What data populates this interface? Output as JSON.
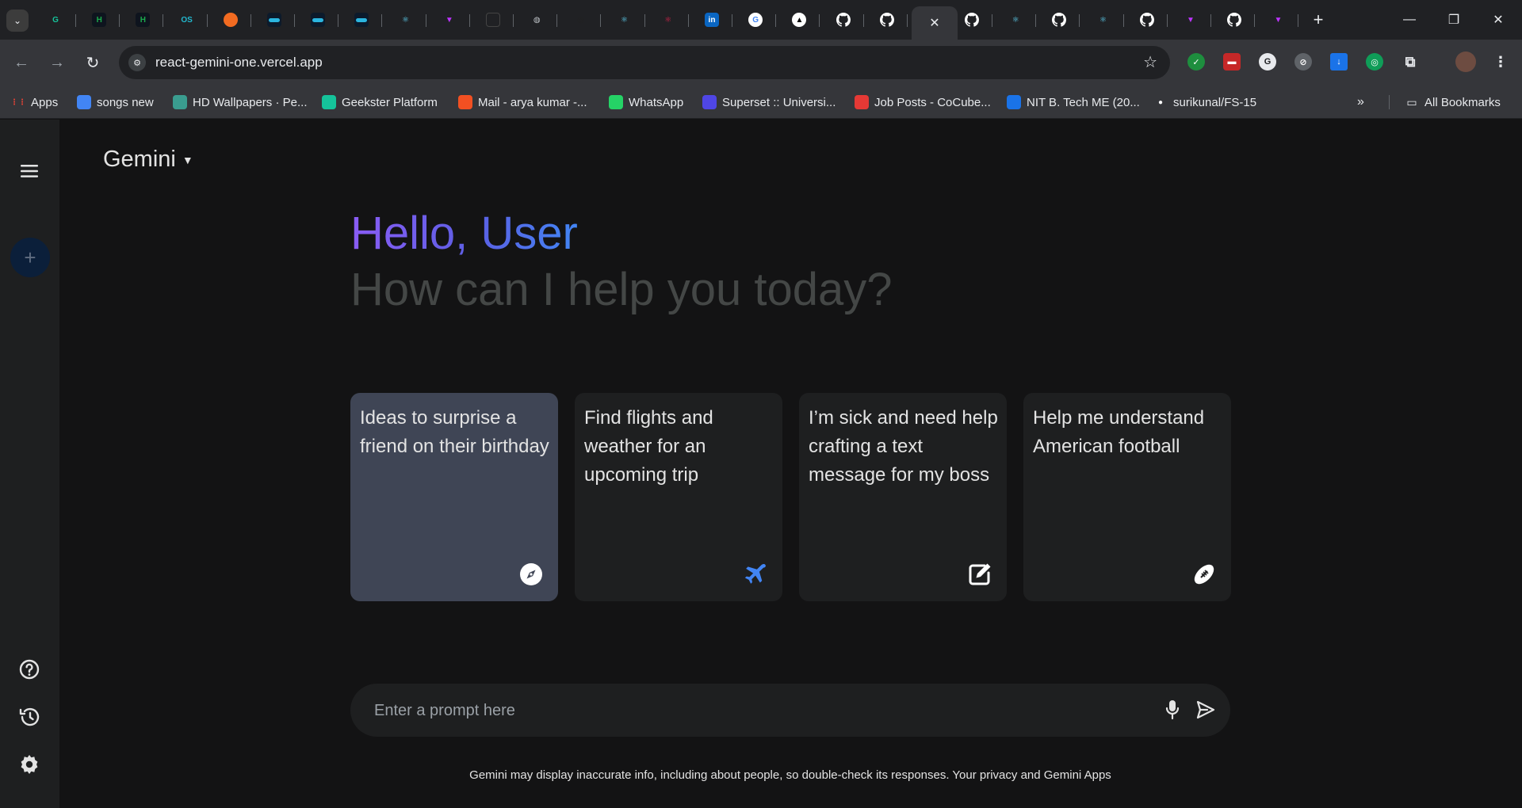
{
  "browser": {
    "tabs": [
      {
        "icon": "tab-list-icon"
      },
      {
        "icon": "grammarly-icon",
        "glyph": "G",
        "color": "#15c39a"
      },
      {
        "icon": "hackerrank-icon",
        "glyph": "H",
        "color": "#1ba94c"
      },
      {
        "icon": "hackerrank-icon",
        "glyph": "H",
        "color": "#1ba94c"
      },
      {
        "icon": "os-icon",
        "glyph": "OS",
        "color": "#22b8cf"
      },
      {
        "icon": "orange-circle-icon",
        "glyph": "",
        "color": "#f26b21"
      },
      {
        "icon": "dash-icon",
        "glyph": "",
        "color": "#2bb6e0"
      },
      {
        "icon": "dash-icon",
        "glyph": "",
        "color": "#2bb6e0"
      },
      {
        "icon": "dash-icon",
        "glyph": "",
        "color": "#2bb6e0"
      },
      {
        "icon": "react-icon",
        "glyph": "⚛",
        "color": "#61dafb"
      },
      {
        "icon": "vite-icon",
        "glyph": "▼",
        "color": "#bd34fe"
      },
      {
        "icon": "blank-icon",
        "glyph": "",
        "color": "#444"
      },
      {
        "icon": "globe-icon",
        "glyph": "◍",
        "color": "#bdc1c6"
      },
      {
        "icon": "openai-icon",
        "glyph": "◎",
        "color": "#222"
      },
      {
        "icon": "react-icon",
        "glyph": "⚛",
        "color": "#61dafb"
      },
      {
        "icon": "react-icon",
        "glyph": "⚛",
        "color": "#e0234e"
      },
      {
        "icon": "linkedin-icon",
        "glyph": "in",
        "color": "#0a66c2"
      },
      {
        "icon": "google-icon",
        "glyph": "G",
        "color": "#ffffff"
      },
      {
        "icon": "vercel-icon",
        "glyph": "▲",
        "color": "#ffffff"
      },
      {
        "icon": "github-icon",
        "glyph": "",
        "color": "#ffffff"
      },
      {
        "icon": "github-icon",
        "glyph": "",
        "color": "#ffffff"
      }
    ],
    "active_tab_close": "✕",
    "more_tabs": [
      {
        "icon": "github-icon",
        "glyph": "",
        "color": "#ffffff"
      },
      {
        "icon": "react-icon",
        "glyph": "⚛",
        "color": "#61dafb"
      },
      {
        "icon": "github-icon",
        "glyph": "",
        "color": "#ffffff"
      },
      {
        "icon": "react-icon",
        "glyph": "⚛",
        "color": "#61dafb"
      },
      {
        "icon": "github-icon",
        "glyph": "",
        "color": "#ffffff"
      },
      {
        "icon": "vite-icon",
        "glyph": "▼",
        "color": "#bd34fe"
      },
      {
        "icon": "github-icon",
        "glyph": "",
        "color": "#ffffff"
      },
      {
        "icon": "vite-icon",
        "glyph": "▼",
        "color": "#bd34fe"
      }
    ],
    "url": "react-gemini-one.vercel.app",
    "bookmarks": [
      {
        "label": "Apps",
        "icon": "apps-grid-icon",
        "color": "#ea4335"
      },
      {
        "label": "songs new",
        "icon": "radio-icon",
        "color": "#4285f4"
      },
      {
        "label": "HD Wallpapers · Pe...",
        "icon": "wallpaper-icon",
        "color": "#3a9d8f"
      },
      {
        "label": "Geekster Platform",
        "icon": "geekster-icon",
        "color": "#15c39a"
      },
      {
        "label": "Mail - arya kumar -...",
        "icon": "microsoft-icon",
        "color": "#f25022"
      },
      {
        "label": "WhatsApp",
        "icon": "whatsapp-icon",
        "color": "#25d366"
      },
      {
        "label": "Superset :: Universi...",
        "icon": "superset-icon",
        "color": "#4f46e5"
      },
      {
        "label": "Job Posts - CoCube...",
        "icon": "cocubes-icon",
        "color": "#e53935"
      },
      {
        "label": "NIT B. Tech ME (20...",
        "icon": "c-icon",
        "color": "#1a73e8"
      },
      {
        "label": "surikunal/FS-15",
        "icon": "github-icon",
        "color": "#ffffff"
      }
    ],
    "all_bookmarks": "All Bookmarks"
  },
  "app": {
    "brand": "Gemini",
    "greeting": "Hello, User",
    "subgreeting": "How can I help you today?",
    "cards": [
      {
        "text": "Ideas to surprise a friend on their birthday",
        "icon": "compass-icon",
        "icon_color": "#ffffff"
      },
      {
        "text": "Find flights and weather for an upcoming trip",
        "icon": "plane-icon",
        "icon_color": "#4285f4"
      },
      {
        "text": "I’m sick and need help crafting a text message for my boss",
        "icon": "edit-icon",
        "icon_color": "#ffffff"
      },
      {
        "text": "Help me understand American football",
        "icon": "football-icon",
        "icon_color": "#ffffff"
      }
    ],
    "prompt_placeholder": "Enter a prompt here",
    "disclaimer": "Gemini may display inaccurate info, including about people, so double-check its responses. Your privacy and Gemini Apps"
  }
}
